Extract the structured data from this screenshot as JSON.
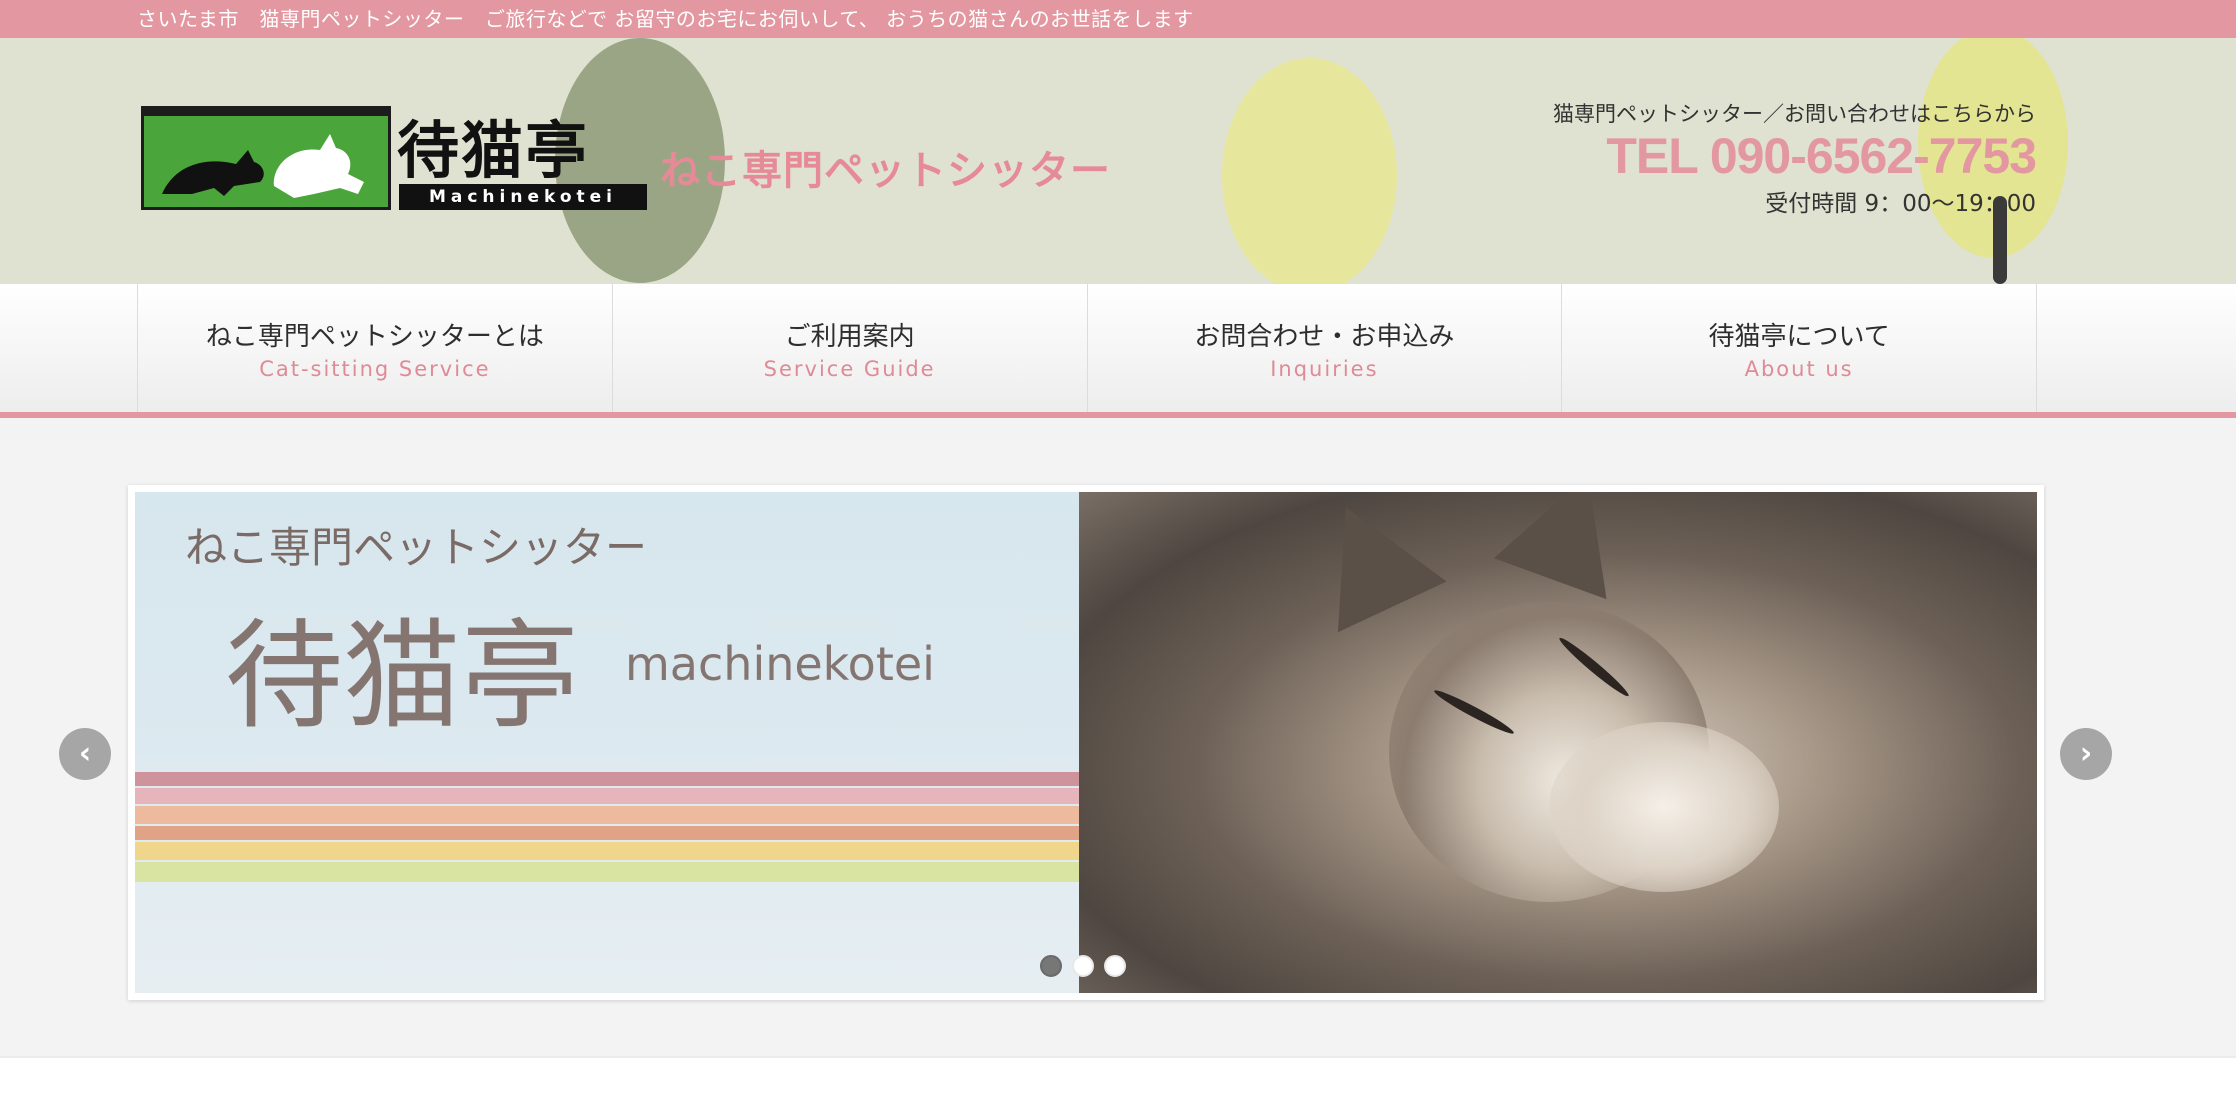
{
  "topbar": {
    "text": "さいたま市　猫専門ペットシッター　ご旅行などで お留守のお宅にお伺いして、 おうちの猫さんのお世話をします"
  },
  "header": {
    "logo_title": "待猫亭",
    "logo_sub": "Machinekotei",
    "tagline": "ねこ専門ペットシッター",
    "contact_lead": "猫専門ペットシッター／お問い合わせはこちらから",
    "tel": "TEL 090-6562-7753",
    "hours": "受付時間 9：00〜19：00"
  },
  "nav": {
    "items": [
      {
        "ja": "ねこ専門ペットシッターとは",
        "en": "Cat-sitting Service"
      },
      {
        "ja": "ご利用案内",
        "en": "Service Guide"
      },
      {
        "ja": "お問合わせ・お申込み",
        "en": "Inquiries"
      },
      {
        "ja": "待猫亭について",
        "en": "About us"
      }
    ]
  },
  "slider": {
    "kicker": "ねこ専門ペットシッター",
    "title": "待猫亭",
    "romaji": "machinekotei",
    "prev_icon": "chevron-left-icon",
    "next_icon": "chevron-right-icon",
    "prev_glyph": "‹",
    "next_glyph": "›",
    "slide_count": 3,
    "active_slide": 1
  },
  "colors": {
    "accent_pink": "#e397a0",
    "header_bg": "#dfe2d0",
    "logo_green": "#4aa63a"
  }
}
